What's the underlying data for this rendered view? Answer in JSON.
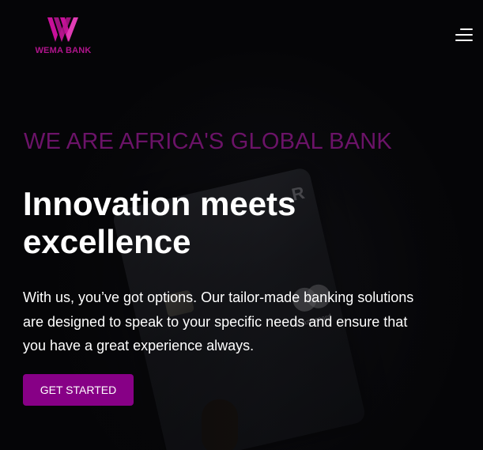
{
  "header": {
    "brand_name": "WEMA BANK",
    "menu_icon": "hamburger-menu-icon"
  },
  "hero": {
    "tagline": "WE ARE AFRICA'S GLOBAL BANK",
    "headline_line1": "Innovation meets",
    "headline_line2": "excellence",
    "description_line1": "With us, you’ve got options. Our tailor-made banking solutions",
    "description_line2": "are designed to speak to your specific needs and ensure that",
    "description_line3": "you have a great experience always.",
    "cta_label": "GET STARTED"
  },
  "colors": {
    "brand_purple": "#870086",
    "logo_magenta": "#b0148c",
    "tagline_purple": "#6b1368",
    "background": "#050507"
  }
}
